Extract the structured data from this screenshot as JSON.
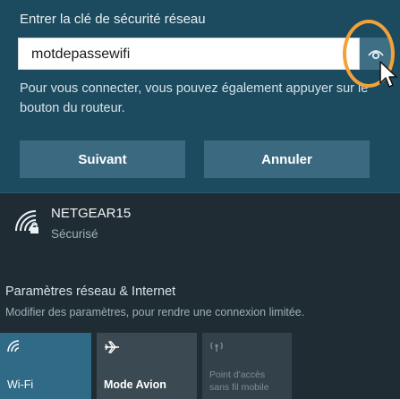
{
  "connect": {
    "prompt": "Entrer la clé de sécurité réseau",
    "password_value": "motdepassewifi",
    "hint": "Pour vous connecter, vous pouvez également appuyer sur le bouton du routeur.",
    "next_label": "Suivant",
    "cancel_label": "Annuler",
    "reveal_icon": "eye-icon"
  },
  "network": {
    "name": "NETGEAR15",
    "status": "Sécurisé",
    "icon": "wifi-secured-icon"
  },
  "settings": {
    "link_label": "Paramètres réseau & Internet",
    "description": "Modifier des paramètres, pour rendre une connexion limitée."
  },
  "quick_actions": {
    "wifi_label": "Wi-Fi",
    "airplane_label": "Mode Avion",
    "hotspot_label": "Point d'accès sans fil mobile"
  },
  "colors": {
    "accent_ring": "#f2a23a",
    "panel_selected": "#1c4a5e",
    "button": "#3b6a80",
    "tile_active": "#2f6a86"
  }
}
